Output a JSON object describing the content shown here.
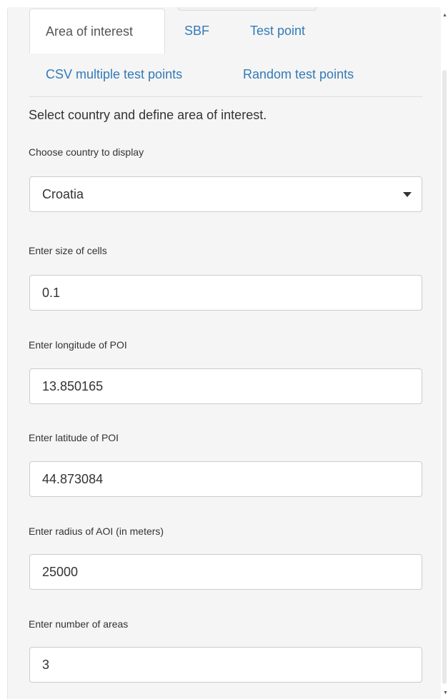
{
  "tabs": [
    {
      "label": "Area of interest",
      "active": true
    },
    {
      "label": "SBF",
      "active": false
    },
    {
      "label": "Test point",
      "active": false
    },
    {
      "label": "CSV multiple test points",
      "active": false
    },
    {
      "label": "Random test points",
      "active": false
    }
  ],
  "intro_text": "Select country and define area of interest.",
  "country": {
    "label": "Choose country to display",
    "selected": "Croatia",
    "icon": "caret-down-icon"
  },
  "cell_size": {
    "label": "Enter size of cells",
    "value": "0.1"
  },
  "longitude": {
    "label": "Enter longitude of POI",
    "value": "13.850165"
  },
  "latitude": {
    "label": "Enter latitude of POI",
    "value": "44.873084"
  },
  "radius": {
    "label": "Enter radius of AOI (in meters)",
    "value": "25000"
  },
  "num_areas": {
    "label": "Enter number of areas",
    "value": "3"
  },
  "colors": {
    "link": "#337ab7",
    "panel_bg": "#f5f5f5",
    "border": "#cccccc",
    "text": "#333333"
  }
}
